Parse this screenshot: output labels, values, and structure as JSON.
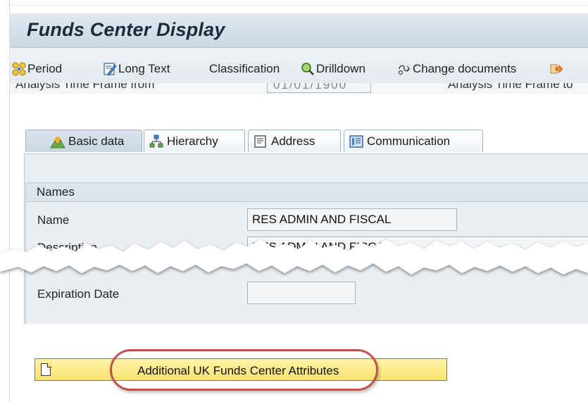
{
  "window": {
    "title": "Funds Center Display"
  },
  "toolbar": {
    "items": [
      {
        "label": "Period",
        "icon": "period-icon"
      },
      {
        "label": "Long Text",
        "icon": "long-text-icon"
      },
      {
        "label": "Classification",
        "icon": ""
      },
      {
        "label": "Drilldown",
        "icon": "drilldown-icon"
      },
      {
        "label": "Change documents",
        "icon": "change-documents-icon"
      },
      {
        "label": "",
        "icon": "exit-arrow-icon"
      }
    ]
  },
  "header_fields": {
    "analysis_from_label": "Analysis Time Frame from",
    "analysis_from_value": "01/01/1900",
    "analysis_to_label": "Analysis Time Frame to"
  },
  "tabs": [
    {
      "label": "Basic data",
      "icon": "basic-data-icon",
      "active": true
    },
    {
      "label": "Hierarchy",
      "icon": "hierarchy-icon",
      "active": false
    },
    {
      "label": "Address",
      "icon": "address-icon",
      "active": false
    },
    {
      "label": "Communication",
      "icon": "communication-icon",
      "active": false
    }
  ],
  "names_group": {
    "title": "Names",
    "name_label": "Name",
    "name_value": "RES ADMIN AND FISCAL",
    "description_label": "Description",
    "description_value": "RES ADMIN AND FISCAL",
    "expiration_label": "Expiration Date",
    "expiration_value": ""
  },
  "attributes_button": {
    "label": "Additional UK Funds Center Attributes"
  },
  "colors": {
    "title_bg": "#cad8e5",
    "button_yellow": "#f9e270",
    "highlight_red": "#c0504d"
  }
}
